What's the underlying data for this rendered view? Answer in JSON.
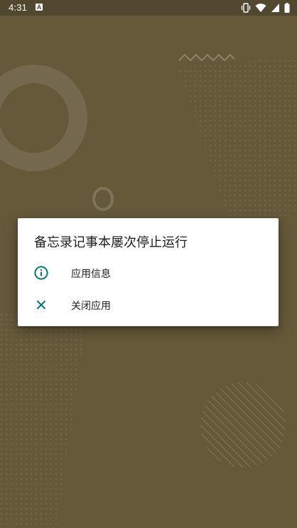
{
  "status_bar": {
    "time": "4:31",
    "notification_icon": "a-badge-icon",
    "status_icons": [
      "vibrate-icon",
      "wifi-icon",
      "signal-icon",
      "battery-icon"
    ]
  },
  "dialog": {
    "title": "备忘录记事本屡次停止运行",
    "options": [
      {
        "icon": "info-icon",
        "label": "应用信息"
      },
      {
        "icon": "close-icon",
        "label": "关闭应用"
      }
    ]
  },
  "colors": {
    "background": "#65593a",
    "status_bar": "#51482f",
    "dialog_background": "#ffffff",
    "icon_accent": "#00796b",
    "text_primary": "#212121"
  }
}
